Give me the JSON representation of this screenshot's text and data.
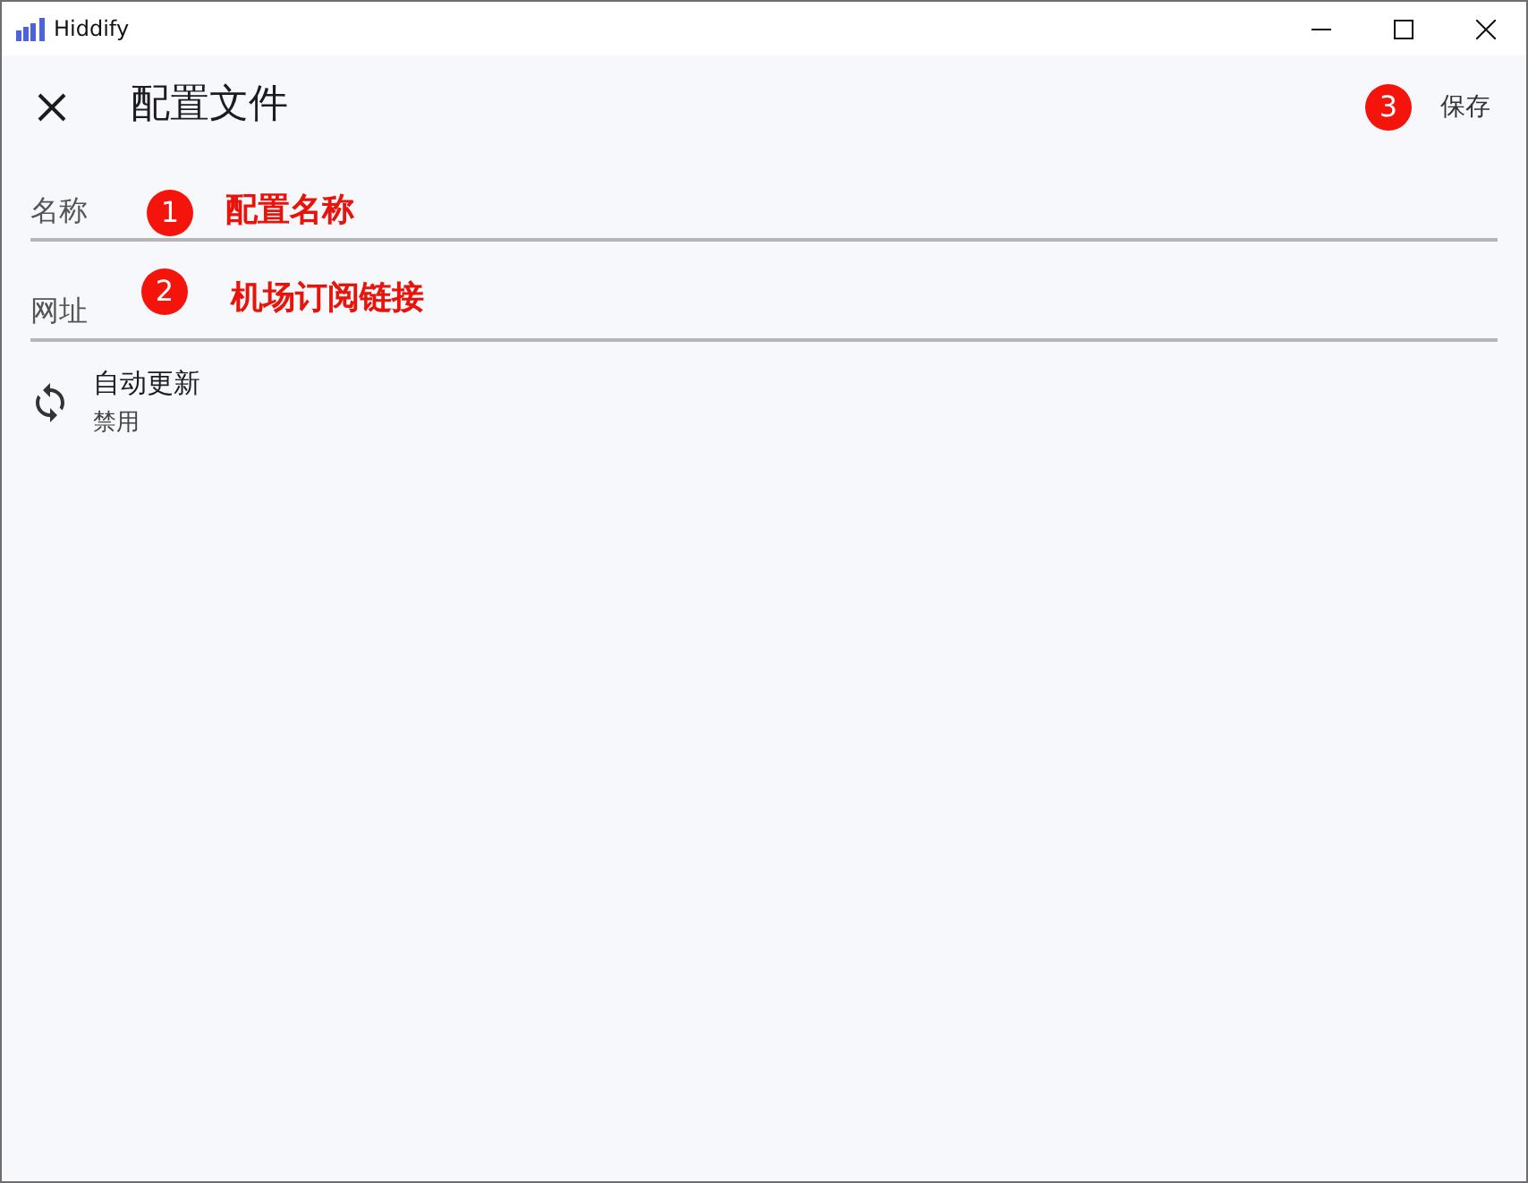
{
  "window": {
    "title": "Hiddify"
  },
  "app_bar": {
    "title": "配置文件",
    "save_label": "保存",
    "annotation": {
      "number": "3"
    }
  },
  "fields": [
    {
      "placeholder": "名称",
      "annotation": {
        "number": "1",
        "text": "配置名称"
      }
    },
    {
      "placeholder": "网址",
      "annotation": {
        "number": "2",
        "text": "机场订阅链接"
      }
    }
  ],
  "settings": [
    {
      "title": "自动更新",
      "subtitle": "禁用"
    }
  ]
}
